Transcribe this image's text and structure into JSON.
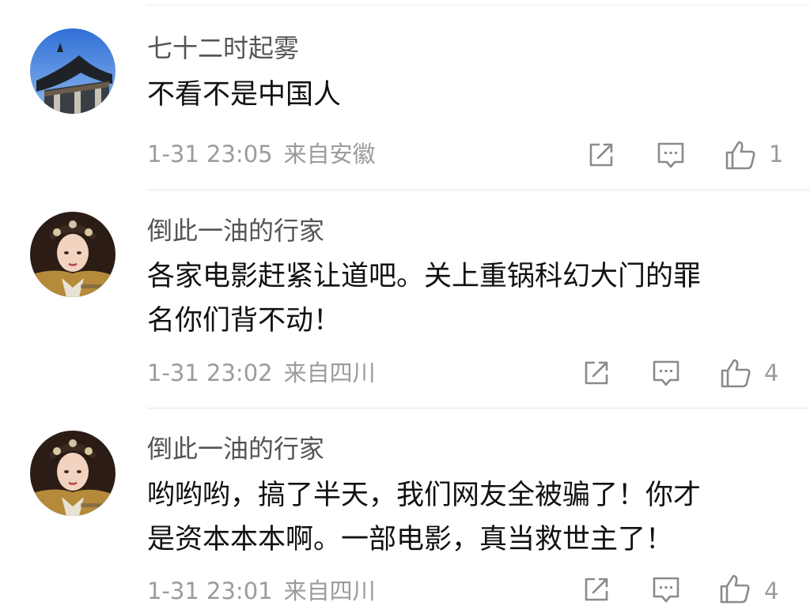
{
  "comments": [
    {
      "avatar": "pavilion-roof-avatar",
      "username": "七十二时起雾",
      "lines": [
        "不看不是中国人"
      ],
      "time": "1-31 23:05",
      "location": "来自安徽",
      "likes": "1"
    },
    {
      "avatar": "costume-drama-actress-avatar",
      "username": "倒此一油的行家",
      "lines": [
        "各家电影赶紧让道吧。关上重锅科幻大门的罪",
        "名你们背不动！"
      ],
      "time": "1-31 23:02",
      "location": "来自四川",
      "likes": "4"
    },
    {
      "avatar": "costume-drama-actress-avatar",
      "username": "倒此一油的行家",
      "lines": [
        "哟哟哟，搞了半天，我们网友全被骗了！你才",
        "是资本本本啊。一部电影，真当救世主了！"
      ],
      "time": "1-31 23:01",
      "location": "来自四川",
      "likes": "4"
    }
  ],
  "icons": {
    "share": "share-icon",
    "reply": "comment-icon",
    "like": "thumbs-up-icon"
  },
  "colors": {
    "username": "#555555",
    "text": "#111111",
    "meta": "#9b9b9b",
    "icon": "#8a8a8a",
    "divider": "#e6e6e6"
  }
}
